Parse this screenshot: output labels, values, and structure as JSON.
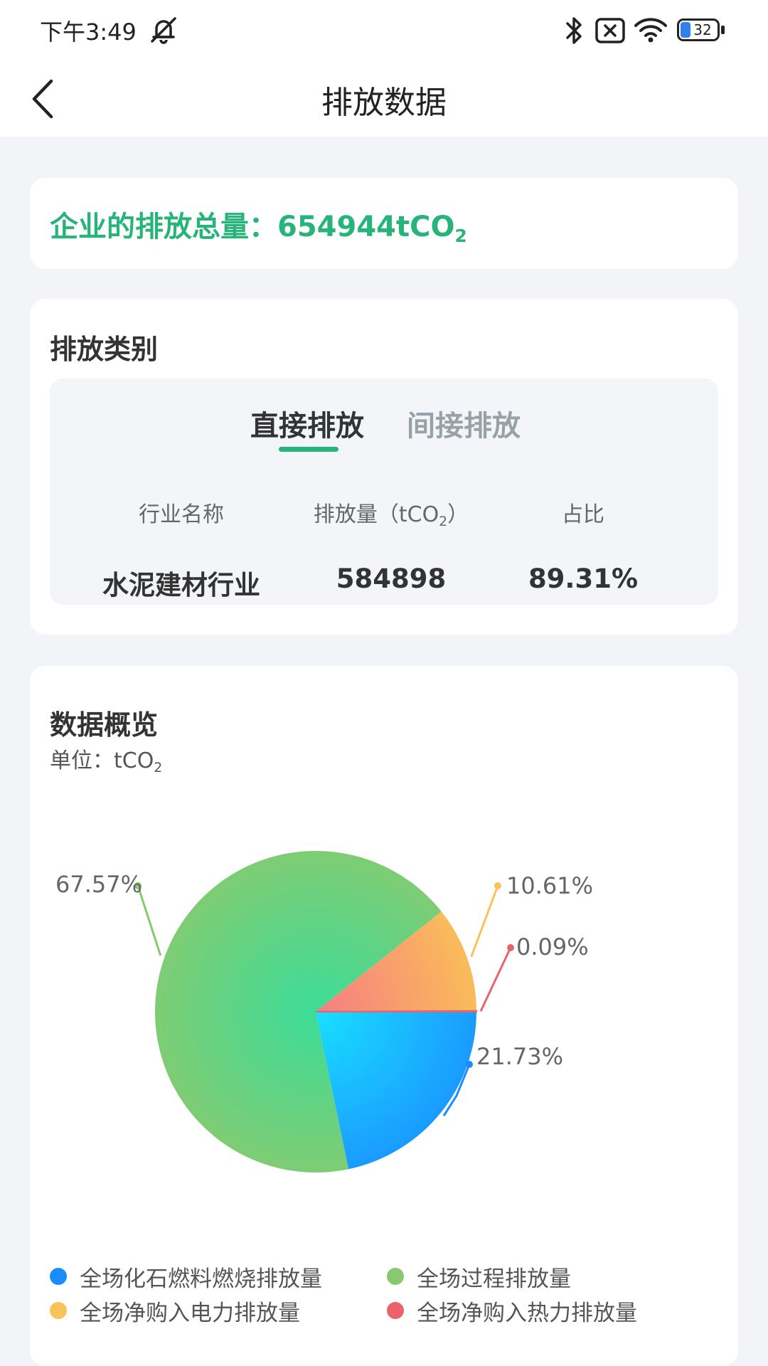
{
  "status_bar": {
    "time": "下午3:49",
    "battery": "32"
  },
  "nav": {
    "title": "排放数据"
  },
  "total": {
    "label": "企业的排放总量：",
    "value": "654944",
    "unit_base": "tCO",
    "unit_sub": "2"
  },
  "category": {
    "title": "排放类别",
    "tabs": [
      {
        "label": "直接排放",
        "active": true
      },
      {
        "label": "间接排放",
        "active": false
      }
    ],
    "columns": {
      "industry": "行业名称",
      "emission_prefix": "排放量（tCO",
      "emission_sub": "2",
      "emission_suffix": "）",
      "ratio": "占比"
    },
    "row": {
      "industry": "水泥建材行业",
      "emission": "584898",
      "ratio": "89.31%"
    }
  },
  "overview": {
    "title": "数据概览",
    "unit_prefix": "单位：tCO",
    "unit_sub": "2"
  },
  "chart_data": {
    "type": "pie",
    "slices": [
      {
        "name": "全场化石燃料燃烧排放量",
        "percent": 21.73,
        "label": "21.73%",
        "color": "#1a8cff"
      },
      {
        "name": "全场过程排放量",
        "percent": 67.57,
        "label": "67.57%",
        "color": "#86c96e"
      },
      {
        "name": "全场净购入电力排放量",
        "percent": 10.61,
        "label": "10.61%",
        "color": "#f8c45a"
      },
      {
        "name": "全场净购入热力排放量",
        "percent": 0.09,
        "label": "0.09%",
        "color": "#e8646a"
      }
    ],
    "legend_placement": "bottom"
  }
}
